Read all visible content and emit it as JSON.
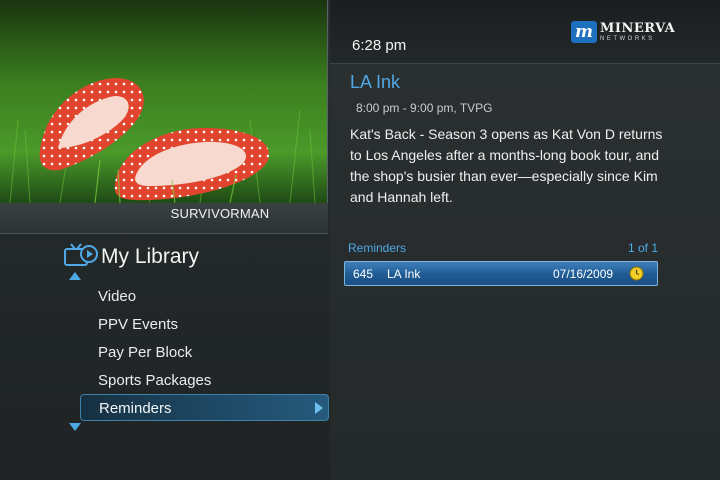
{
  "preview": {
    "caption": "SURVIVORMAN"
  },
  "header": {
    "time": "6:28 pm",
    "logo": {
      "name": "MINERVA",
      "sub": "NETWORKS"
    }
  },
  "program": {
    "title": "LA Ink",
    "time_rating": "8:00 pm - 9:00 pm, TVPG",
    "description": "Kat's Back - Season 3 opens as Kat Von D returns to Los Angeles after a months-long book tour, and the shop's busier than ever—especially since Kim and Hannah left."
  },
  "reminders": {
    "label": "Reminders",
    "count": "1 of 1",
    "rows": [
      {
        "channel": "645",
        "title": "LA Ink",
        "date": "07/16/2009"
      }
    ]
  },
  "library": {
    "title": "My Library",
    "items": [
      {
        "label": "Video"
      },
      {
        "label": "PPV Events"
      },
      {
        "label": "Pay Per Block"
      },
      {
        "label": "Sports Packages"
      },
      {
        "label": "Reminders"
      }
    ]
  },
  "colors": {
    "accent": "#4fa9e6",
    "selection": "#1f5b93",
    "background": "#262b2c"
  }
}
